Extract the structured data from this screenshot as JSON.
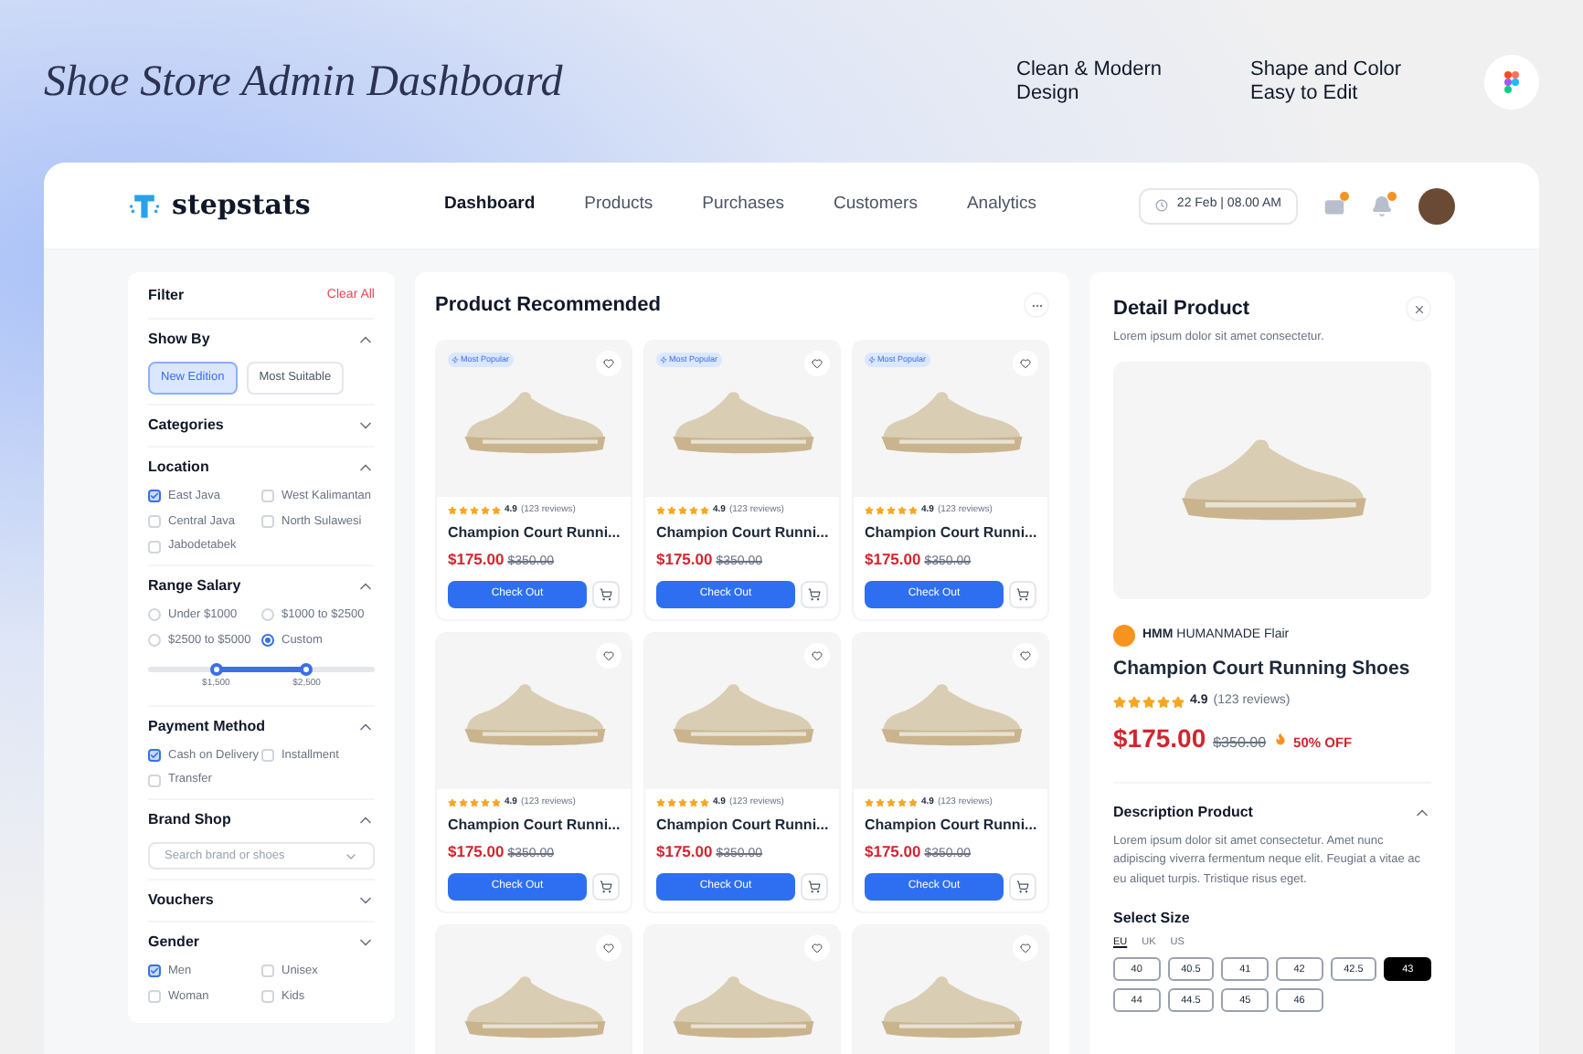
{
  "promo": {
    "title": "Shoe Store Admin Dashboard",
    "features": [
      "Clean & Modern Design",
      "Shape and Color Easy to Edit"
    ]
  },
  "header": {
    "logo": "stepstats",
    "nav": [
      {
        "label": "Dashboard",
        "selected": true
      },
      {
        "label": "Products",
        "selected": false
      },
      {
        "label": "Purchases",
        "selected": false
      },
      {
        "label": "Customers",
        "selected": false
      },
      {
        "label": "Analytics",
        "selected": false
      }
    ],
    "datetime": "22 Feb | 08.00 AM"
  },
  "filter": {
    "title": "Filter",
    "clear": "Clear All",
    "sections": [
      {
        "kind": "chips",
        "title": "Show By",
        "expanded": true,
        "options": [
          {
            "label": "New Edition",
            "selected": true
          },
          {
            "label": "Most Suitable",
            "selected": false
          }
        ]
      },
      {
        "kind": "none",
        "title": "Categories",
        "expanded": false
      },
      {
        "kind": "checks",
        "title": "Location",
        "expanded": true,
        "options": [
          {
            "label": "East Java",
            "checked": true
          },
          {
            "label": "West Kalimantan",
            "checked": false
          },
          {
            "label": "Central Java",
            "checked": false
          },
          {
            "label": "North Sulawesi",
            "checked": false
          },
          {
            "label": "Jabodetabek",
            "checked": false
          }
        ]
      },
      {
        "kind": "radios",
        "title": "Range Salary",
        "expanded": true,
        "options": [
          {
            "label": "Under $1000",
            "selected": false
          },
          {
            "label": "$1000 to $2500",
            "selected": false
          },
          {
            "label": "$2500 to $5000",
            "selected": false
          },
          {
            "label": "Custom",
            "selected": true
          }
        ],
        "thumbs": [
          {
            "level": 0.3,
            "label": "$1,500"
          },
          {
            "level": 0.7,
            "label": "$2,500"
          }
        ]
      },
      {
        "kind": "checks",
        "title": "Payment Method",
        "expanded": true,
        "options": [
          {
            "label": "Cash on Delivery",
            "checked": true
          },
          {
            "label": "Installment",
            "checked": false
          },
          {
            "label": "Transfer",
            "checked": false
          }
        ]
      },
      {
        "kind": "select",
        "title": "Brand Shop",
        "expanded": true,
        "placeholder": "Search brand or shoes"
      },
      {
        "kind": "none",
        "title": "Vouchers",
        "expanded": false
      },
      {
        "kind": "checks",
        "title": "Gender",
        "expanded": false,
        "options": [
          {
            "label": "Men",
            "checked": true
          },
          {
            "label": "Unisex",
            "checked": false
          },
          {
            "label": "Woman",
            "checked": false
          },
          {
            "label": "Kids",
            "checked": false
          }
        ]
      }
    ]
  },
  "products": {
    "title": "Product Recommended",
    "cards": [
      {
        "badge": "Most Popular",
        "liked": false,
        "stars": 5,
        "rating": "4.9",
        "reviews": "(123 reviews)",
        "name": "Champion Court Runni...",
        "price": "$175.00",
        "old_price": "$350.00",
        "button": "Check Out"
      },
      {
        "badge": "Most Popular",
        "liked": false,
        "stars": 5,
        "rating": "4.9",
        "reviews": "(123 reviews)",
        "name": "Champion Court Runni...",
        "price": "$175.00",
        "old_price": "$350.00",
        "button": "Check Out"
      },
      {
        "badge": "Most Popular",
        "liked": false,
        "stars": 5,
        "rating": "4.9",
        "reviews": "(123 reviews)",
        "name": "Champion Court Runni...",
        "price": "$175.00",
        "old_price": "$350.00",
        "button": "Check Out"
      },
      {
        "liked": false,
        "stars": 5,
        "rating": "4.9",
        "reviews": "(123 reviews)",
        "name": "Champion Court Runni...",
        "price": "$175.00",
        "old_price": "$350.00",
        "button": "Check Out"
      },
      {
        "liked": false,
        "stars": 5,
        "rating": "4.9",
        "reviews": "(123 reviews)",
        "name": "Champion Court Runni...",
        "price": "$175.00",
        "old_price": "$350.00",
        "button": "Check Out"
      },
      {
        "liked": false,
        "stars": 5,
        "rating": "4.9",
        "reviews": "(123 reviews)",
        "name": "Champion Court Runni...",
        "price": "$175.00",
        "old_price": "$350.00",
        "button": "Check Out"
      },
      {
        "liked": false
      },
      {
        "liked": false
      },
      {
        "liked": false
      }
    ]
  },
  "detail": {
    "title": "Detail Product",
    "subtitle": "Lorem ipsum dolor sit amet consectetur.",
    "brand": "**HMM** HUMANMADE Flair",
    "name": "Champion Court Running Shoes",
    "stars": 5,
    "rating": "4.9",
    "reviews": "(123 reviews)",
    "price": "$175.00",
    "old_price": "$350.00",
    "discount": "50% OFF",
    "description": {
      "title": "Description Product",
      "expanded": true,
      "text": "Lorem ipsum dolor sit amet consectetur. Amet nunc adipiscing viverra fermentum neque elit. Feugiat a vitae ac eu aliquet turpis. Tristique risus eget."
    },
    "size_title": "Select Size",
    "units": [
      {
        "label": "EU",
        "selected": true
      },
      {
        "label": "UK",
        "selected": false
      },
      {
        "label": "US",
        "selected": false
      }
    ],
    "sizes": [
      {
        "label": "40",
        "selected": false
      },
      {
        "label": "40.5",
        "selected": false
      },
      {
        "label": "41",
        "selected": false
      },
      {
        "label": "42",
        "selected": false
      },
      {
        "label": "42.5",
        "selected": false
      },
      {
        "label": "43",
        "selected": true
      },
      {
        "label": "44",
        "selected": false
      },
      {
        "label": "44.5",
        "selected": false
      },
      {
        "label": "45",
        "selected": false
      },
      {
        "label": "46",
        "selected": false
      }
    ]
  }
}
